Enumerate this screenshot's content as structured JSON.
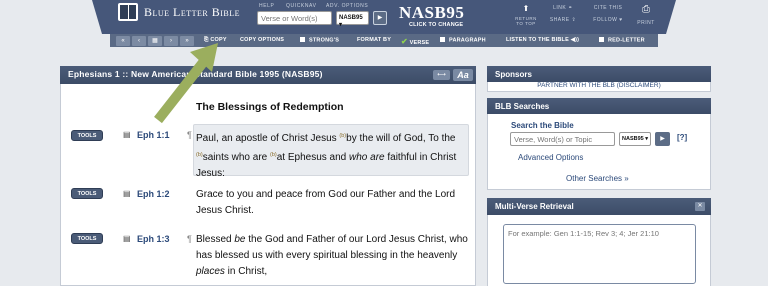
{
  "header": {
    "logo_text": "Blue Letter Bible",
    "help": "HELP",
    "quicknav": "QUICKNAV",
    "adv_options": "ADV. OPTIONS",
    "search_placeholder": "Verse or Word(s)",
    "version": "NASB95",
    "version_title": "NASB95",
    "version_sub": "CLICK TO CHANGE",
    "return_top": "RETURN TO TOP",
    "link": "LINK",
    "share": "SHARE",
    "cite": "CITE THIS",
    "follow": "FOLLOW",
    "print": "PRINT"
  },
  "toolbar": {
    "copy": "COPY",
    "copy_options": "COPY OPTIONS",
    "strongs": "STRONG'S",
    "format_by": "FORMAT BY",
    "verse": "VERSE",
    "paragraph": "PARAGRAPH",
    "listen": "LISTEN TO THE BIBLE",
    "red_letter": "RED-LETTER"
  },
  "main": {
    "title": "Ephesians 1 :: New American Standard Bible 1995 (NASB95)",
    "aa": "Aa",
    "section_heading": "The Blessings of Redemption",
    "verses": [
      {
        "tools": "TOOLS",
        "ref": "Eph 1:1"
      },
      {
        "tools": "TOOLS",
        "ref": "Eph 1:2"
      },
      {
        "tools": "TOOLS",
        "ref": "Eph 1:3"
      }
    ]
  },
  "sidebar": {
    "sponsors_title": "Sponsors",
    "partner_text": "PARTNER WITH THE BLB  (DISCLAIMER)",
    "searches_title": "BLB Searches",
    "search_label": "Search the Bible",
    "search_placeholder": "Verse, Word(s) or Topic",
    "search_version": "NASB95",
    "help_link": "[?]",
    "advanced": "Advanced Options",
    "other": "Other Searches",
    "multiverse_title": "Multi-Verse Retrieval",
    "multiverse_placeholder": "For example: Gen 1:1-15; Rev 3; 4; Jer 21:10"
  },
  "colors": {
    "header_blue": "#3c4d69",
    "link_blue": "#2c4a7a",
    "arrow_green": "#9bae5e"
  }
}
